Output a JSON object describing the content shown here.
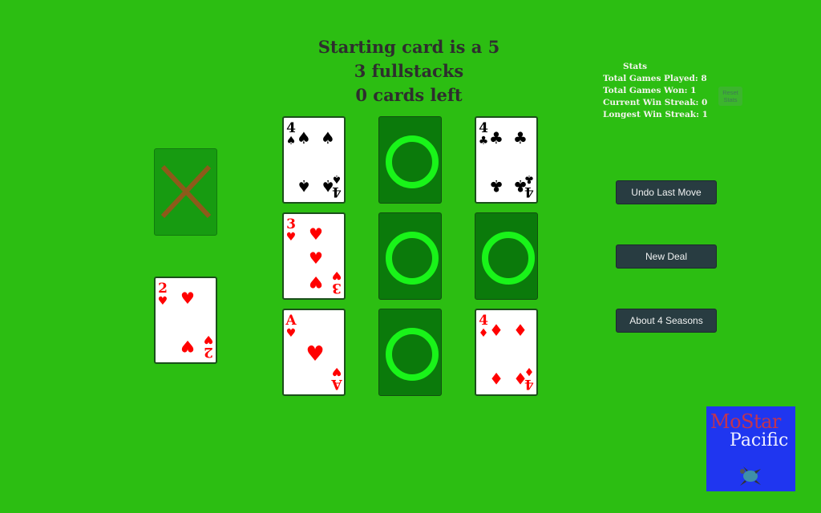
{
  "status": {
    "line1": "Starting card is a 5",
    "line2": "3 fullstacks",
    "line3": "0 cards left"
  },
  "stats": {
    "title": "Stats",
    "rows": [
      "Total Games Played: 8",
      "Total Games Won: 1",
      "Current Win Streak: 0",
      "Longest Win Streak: 1"
    ],
    "reset_line1": "Reset",
    "reset_line2": "Stats"
  },
  "buttons": {
    "undo": "Undo Last Move",
    "new_deal": "New Deal",
    "about": "About 4 Seasons"
  },
  "logo": {
    "line1": "MoStar",
    "line2": "Pacific",
    "icon": "sea-turtle-icon"
  },
  "board": {
    "discard_pile": {
      "state": "empty-x",
      "icon": "x-icon"
    },
    "waste_card": {
      "rank": "2",
      "suit": "hearts",
      "color": "#ff0000"
    },
    "grid": [
      [
        {
          "rank": "4",
          "suit": "spades",
          "color": "#000000"
        },
        {
          "state": "empty"
        },
        {
          "rank": "4",
          "suit": "clubs",
          "color": "#000000"
        }
      ],
      [
        {
          "rank": "3",
          "suit": "hearts",
          "color": "#ff0000"
        },
        {
          "state": "empty"
        },
        {
          "state": "empty"
        }
      ],
      [
        {
          "rank": "A",
          "suit": "hearts",
          "color": "#ff0000"
        },
        {
          "state": "empty"
        },
        {
          "rank": "4",
          "suit": "diamonds",
          "color": "#ff0000"
        }
      ]
    ]
  },
  "colors": {
    "table": "#2cbe12",
    "empty_slot": "#0b7a0b",
    "ring": "#19f419",
    "button": "#283c41"
  }
}
